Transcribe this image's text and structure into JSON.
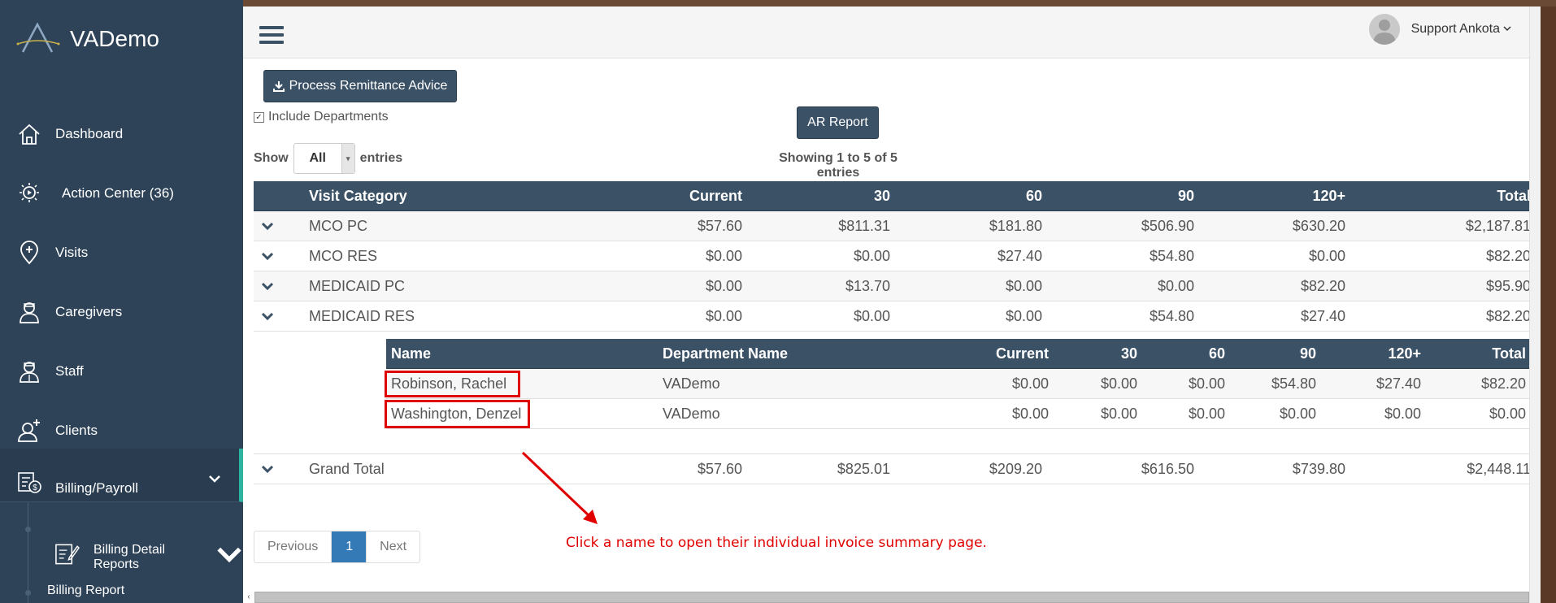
{
  "sidebar": {
    "app_name": "VADemo",
    "items": [
      {
        "label": "Dashboard",
        "icon": "home-icon"
      },
      {
        "label": "Action Center (36)",
        "icon": "action-center-icon"
      },
      {
        "label": "Visits",
        "icon": "visits-icon"
      },
      {
        "label": "Caregivers",
        "icon": "caregiver-icon"
      },
      {
        "label": "Staff",
        "icon": "staff-icon"
      },
      {
        "label": "Clients",
        "icon": "clients-icon"
      },
      {
        "label": "Billing/Payroll",
        "icon": "billing-icon"
      }
    ],
    "sub_detail_label": "Billing Detail Reports",
    "sub_report_label": "Billing Report"
  },
  "header": {
    "user_name": "Support Ankota"
  },
  "toolbar": {
    "remit_label": "Process Remittance Advice",
    "ar_label": "AR Report",
    "include_departments_label": "Include Departments",
    "show_label": "Show",
    "entries_select_value": "All",
    "entries_label": "entries",
    "info_text": "Showing 1 to 5 of 5 entries"
  },
  "table": {
    "headers": [
      "Visit Category",
      "Current",
      "30",
      "60",
      "90",
      "120+",
      "Total"
    ],
    "rows": [
      {
        "cat": "MCO PC",
        "cur": "$57.60",
        "d30": "$811.31",
        "d60": "$181.80",
        "d90": "$506.90",
        "d120": "$630.20",
        "total": "$2,187.81"
      },
      {
        "cat": "MCO RES",
        "cur": "$0.00",
        "d30": "$0.00",
        "d60": "$27.40",
        "d90": "$54.80",
        "d120": "$0.00",
        "total": "$82.20"
      },
      {
        "cat": "MEDICAID PC",
        "cur": "$0.00",
        "d30": "$13.70",
        "d60": "$0.00",
        "d90": "$0.00",
        "d120": "$82.20",
        "total": "$95.90"
      },
      {
        "cat": "MEDICAID RES",
        "cur": "$0.00",
        "d30": "$0.00",
        "d60": "$0.00",
        "d90": "$54.80",
        "d120": "$27.40",
        "total": "$82.20"
      }
    ],
    "grand_total": {
      "cat": "Grand Total",
      "cur": "$57.60",
      "d30": "$825.01",
      "d60": "$209.20",
      "d90": "$616.50",
      "d120": "$739.80",
      "total": "$2,448.11"
    }
  },
  "subtable": {
    "headers": [
      "Name",
      "Department Name",
      "Current",
      "30",
      "60",
      "90",
      "120+",
      "Total"
    ],
    "rows": [
      {
        "name": "Robinson, Rachel",
        "dept": "VADemo",
        "cur": "$0.00",
        "d30": "$0.00",
        "d60": "$0.00",
        "d90": "$54.80",
        "d120": "$27.40",
        "total": "$82.20"
      },
      {
        "name": "Washington, Denzel",
        "dept": "VADemo",
        "cur": "$0.00",
        "d30": "$0.00",
        "d60": "$0.00",
        "d90": "$0.00",
        "d120": "$0.00",
        "total": "$0.00"
      }
    ]
  },
  "pagination": {
    "prev": "Previous",
    "page": "1",
    "next": "Next"
  },
  "annotation": "Click a name to open their individual invoice summary page.",
  "colors": {
    "sidebar": "#2e4357",
    "header_row": "#3b5166",
    "accent": "#2bb5a0",
    "highlight": "#e00000",
    "page_active": "#337ab7"
  }
}
